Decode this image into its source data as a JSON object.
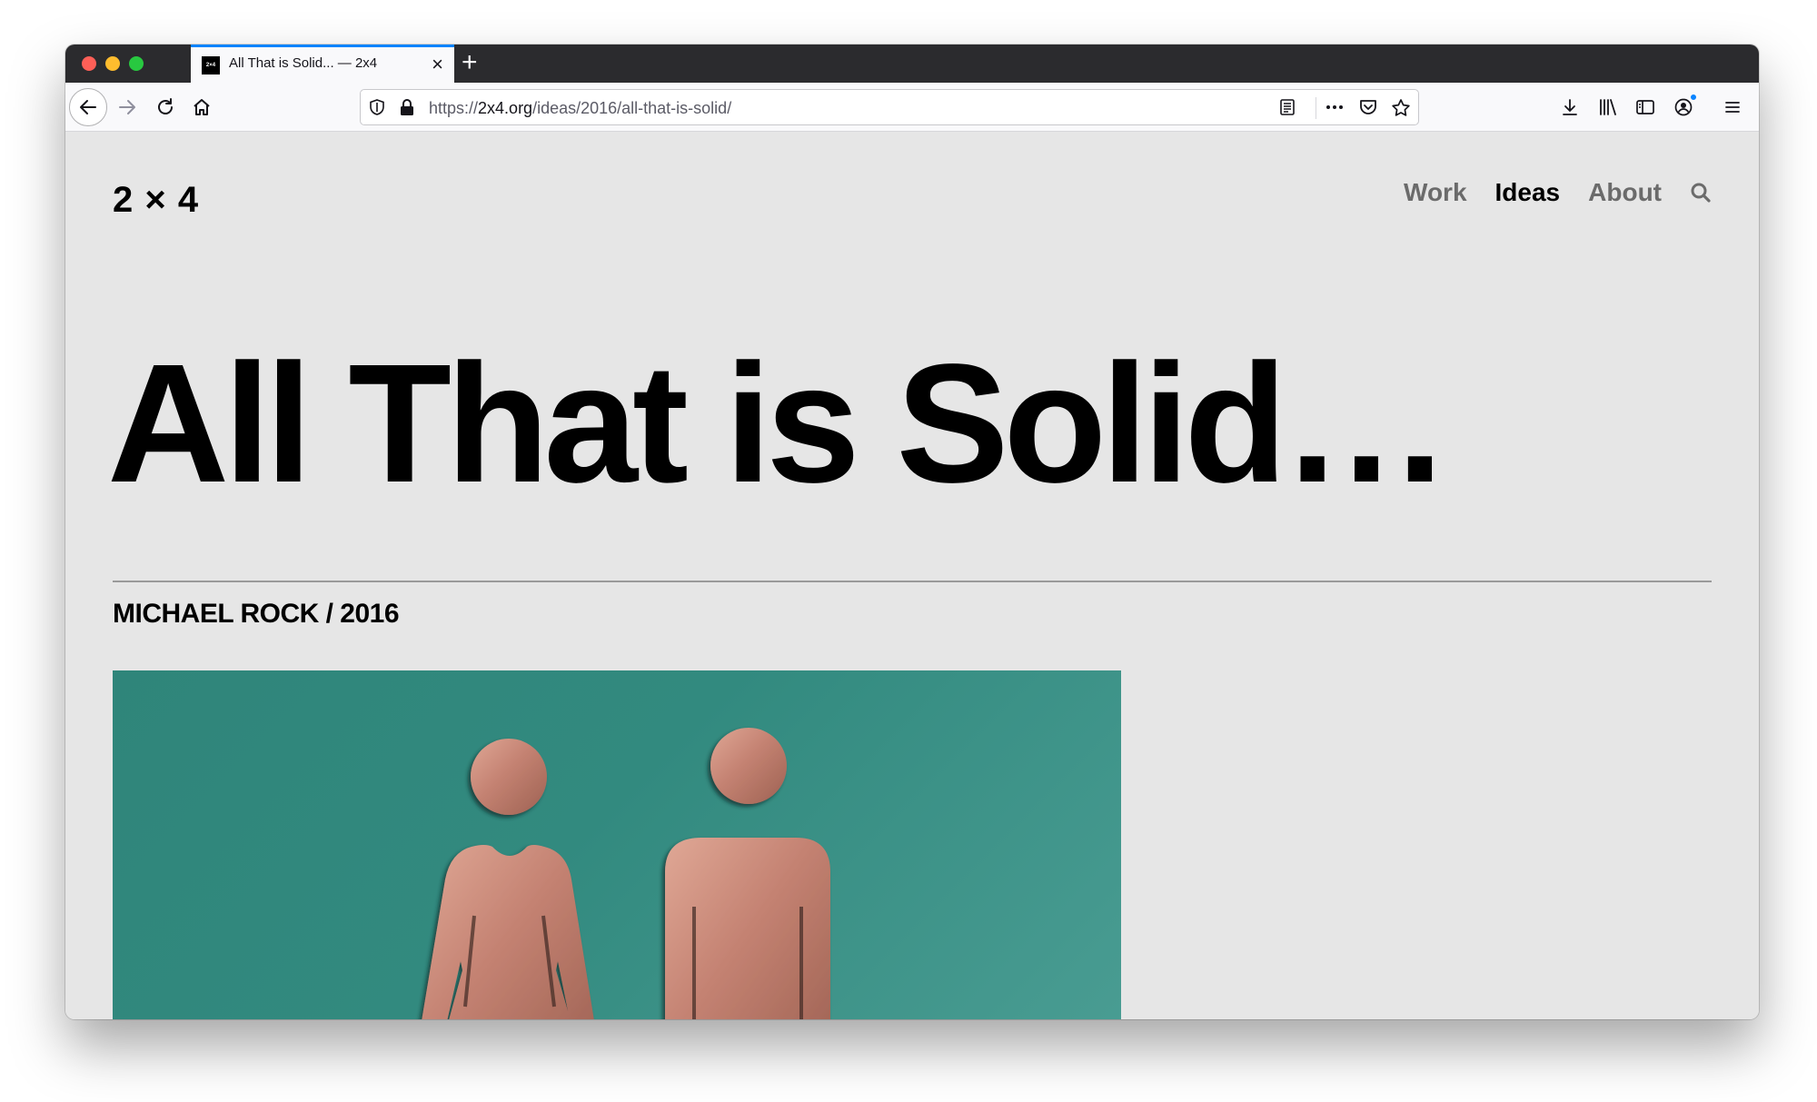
{
  "browser": {
    "tab": {
      "favicon_text": "2×4",
      "title": "All That is Solid... — 2x4"
    },
    "url": {
      "scheme": "https://",
      "host": "2x4.org",
      "path": "/ideas/2016/all-that-is-solid/"
    },
    "icons": {
      "back": "back-arrow-icon",
      "forward": "forward-arrow-icon",
      "reload": "reload-icon",
      "home": "home-icon",
      "shield": "tracking-shield-icon",
      "lock": "lock-icon",
      "reader": "reader-view-icon",
      "more": "more-actions-icon",
      "pocket": "pocket-icon",
      "star": "bookmark-star-icon",
      "download": "download-icon",
      "library": "library-icon",
      "sidebar": "sidebar-icon",
      "account": "account-icon",
      "menu": "hamburger-menu-icon"
    }
  },
  "site": {
    "logo": "2 × 4",
    "nav": [
      {
        "label": "Work",
        "active": false
      },
      {
        "label": "Ideas",
        "active": true
      },
      {
        "label": "About",
        "active": false
      }
    ]
  },
  "article": {
    "title": "All That is Solid…",
    "byline": "MICHAEL ROCK / 2016"
  },
  "colors": {
    "page_bg": "#e6e6e6",
    "hero_teal": "#328a7f",
    "copper": "#c98a78",
    "nav_inactive": "#6b6b6b",
    "accent_blue": "#0a84ff"
  }
}
